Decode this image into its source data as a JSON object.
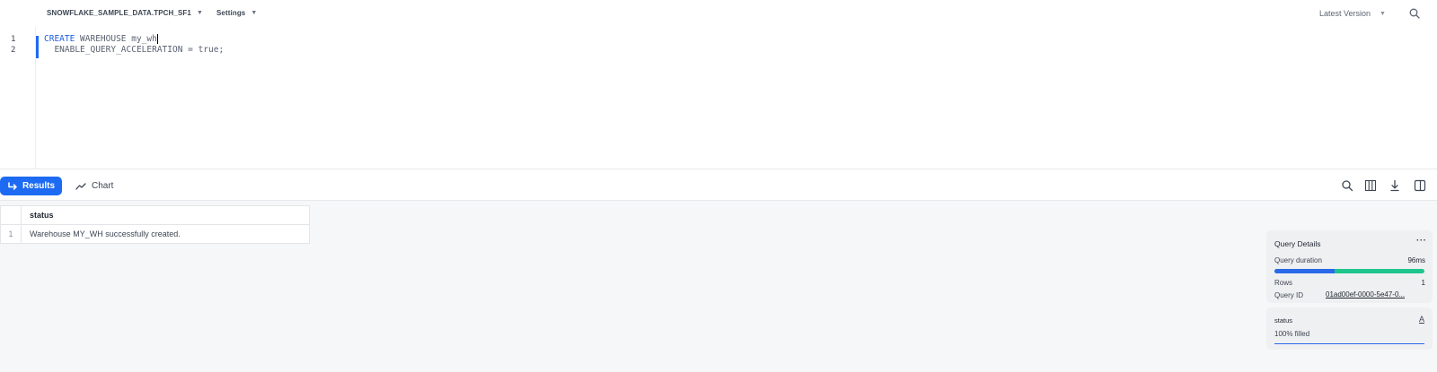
{
  "topbar": {
    "database_context": "SNOWFLAKE_SAMPLE_DATA.TPCH_SF1",
    "settings_label": "Settings",
    "version_label": "Latest Version"
  },
  "editor": {
    "lines": [
      {
        "number": "1",
        "keyword": "CREATE",
        "rest": " WAREHOUSE my_wh"
      },
      {
        "number": "2",
        "keyword": "",
        "rest": "  ENABLE_QUERY_ACCELERATION = true;"
      }
    ]
  },
  "results_bar": {
    "results_label": "Results",
    "chart_label": "Chart"
  },
  "results_table": {
    "columns": [
      "status"
    ],
    "rows": [
      {
        "index": "1",
        "status": "Warehouse MY_WH successfully created."
      }
    ]
  },
  "query_details": {
    "title": "Query Details",
    "more_label": "···",
    "duration_label": "Query duration",
    "duration_value": "96ms",
    "duration_compile_fraction": 0.4,
    "rows_label": "Rows",
    "rows_value": "1",
    "query_id_label": "Query ID",
    "query_id_value": "01ad00ef-0000-5e47-0..."
  },
  "status_panel": {
    "title": "status",
    "icon_label": "A",
    "fill_text": "100% filled"
  },
  "colors": {
    "accent": "#1d6bf2",
    "progress_green": "#1fc58c"
  }
}
